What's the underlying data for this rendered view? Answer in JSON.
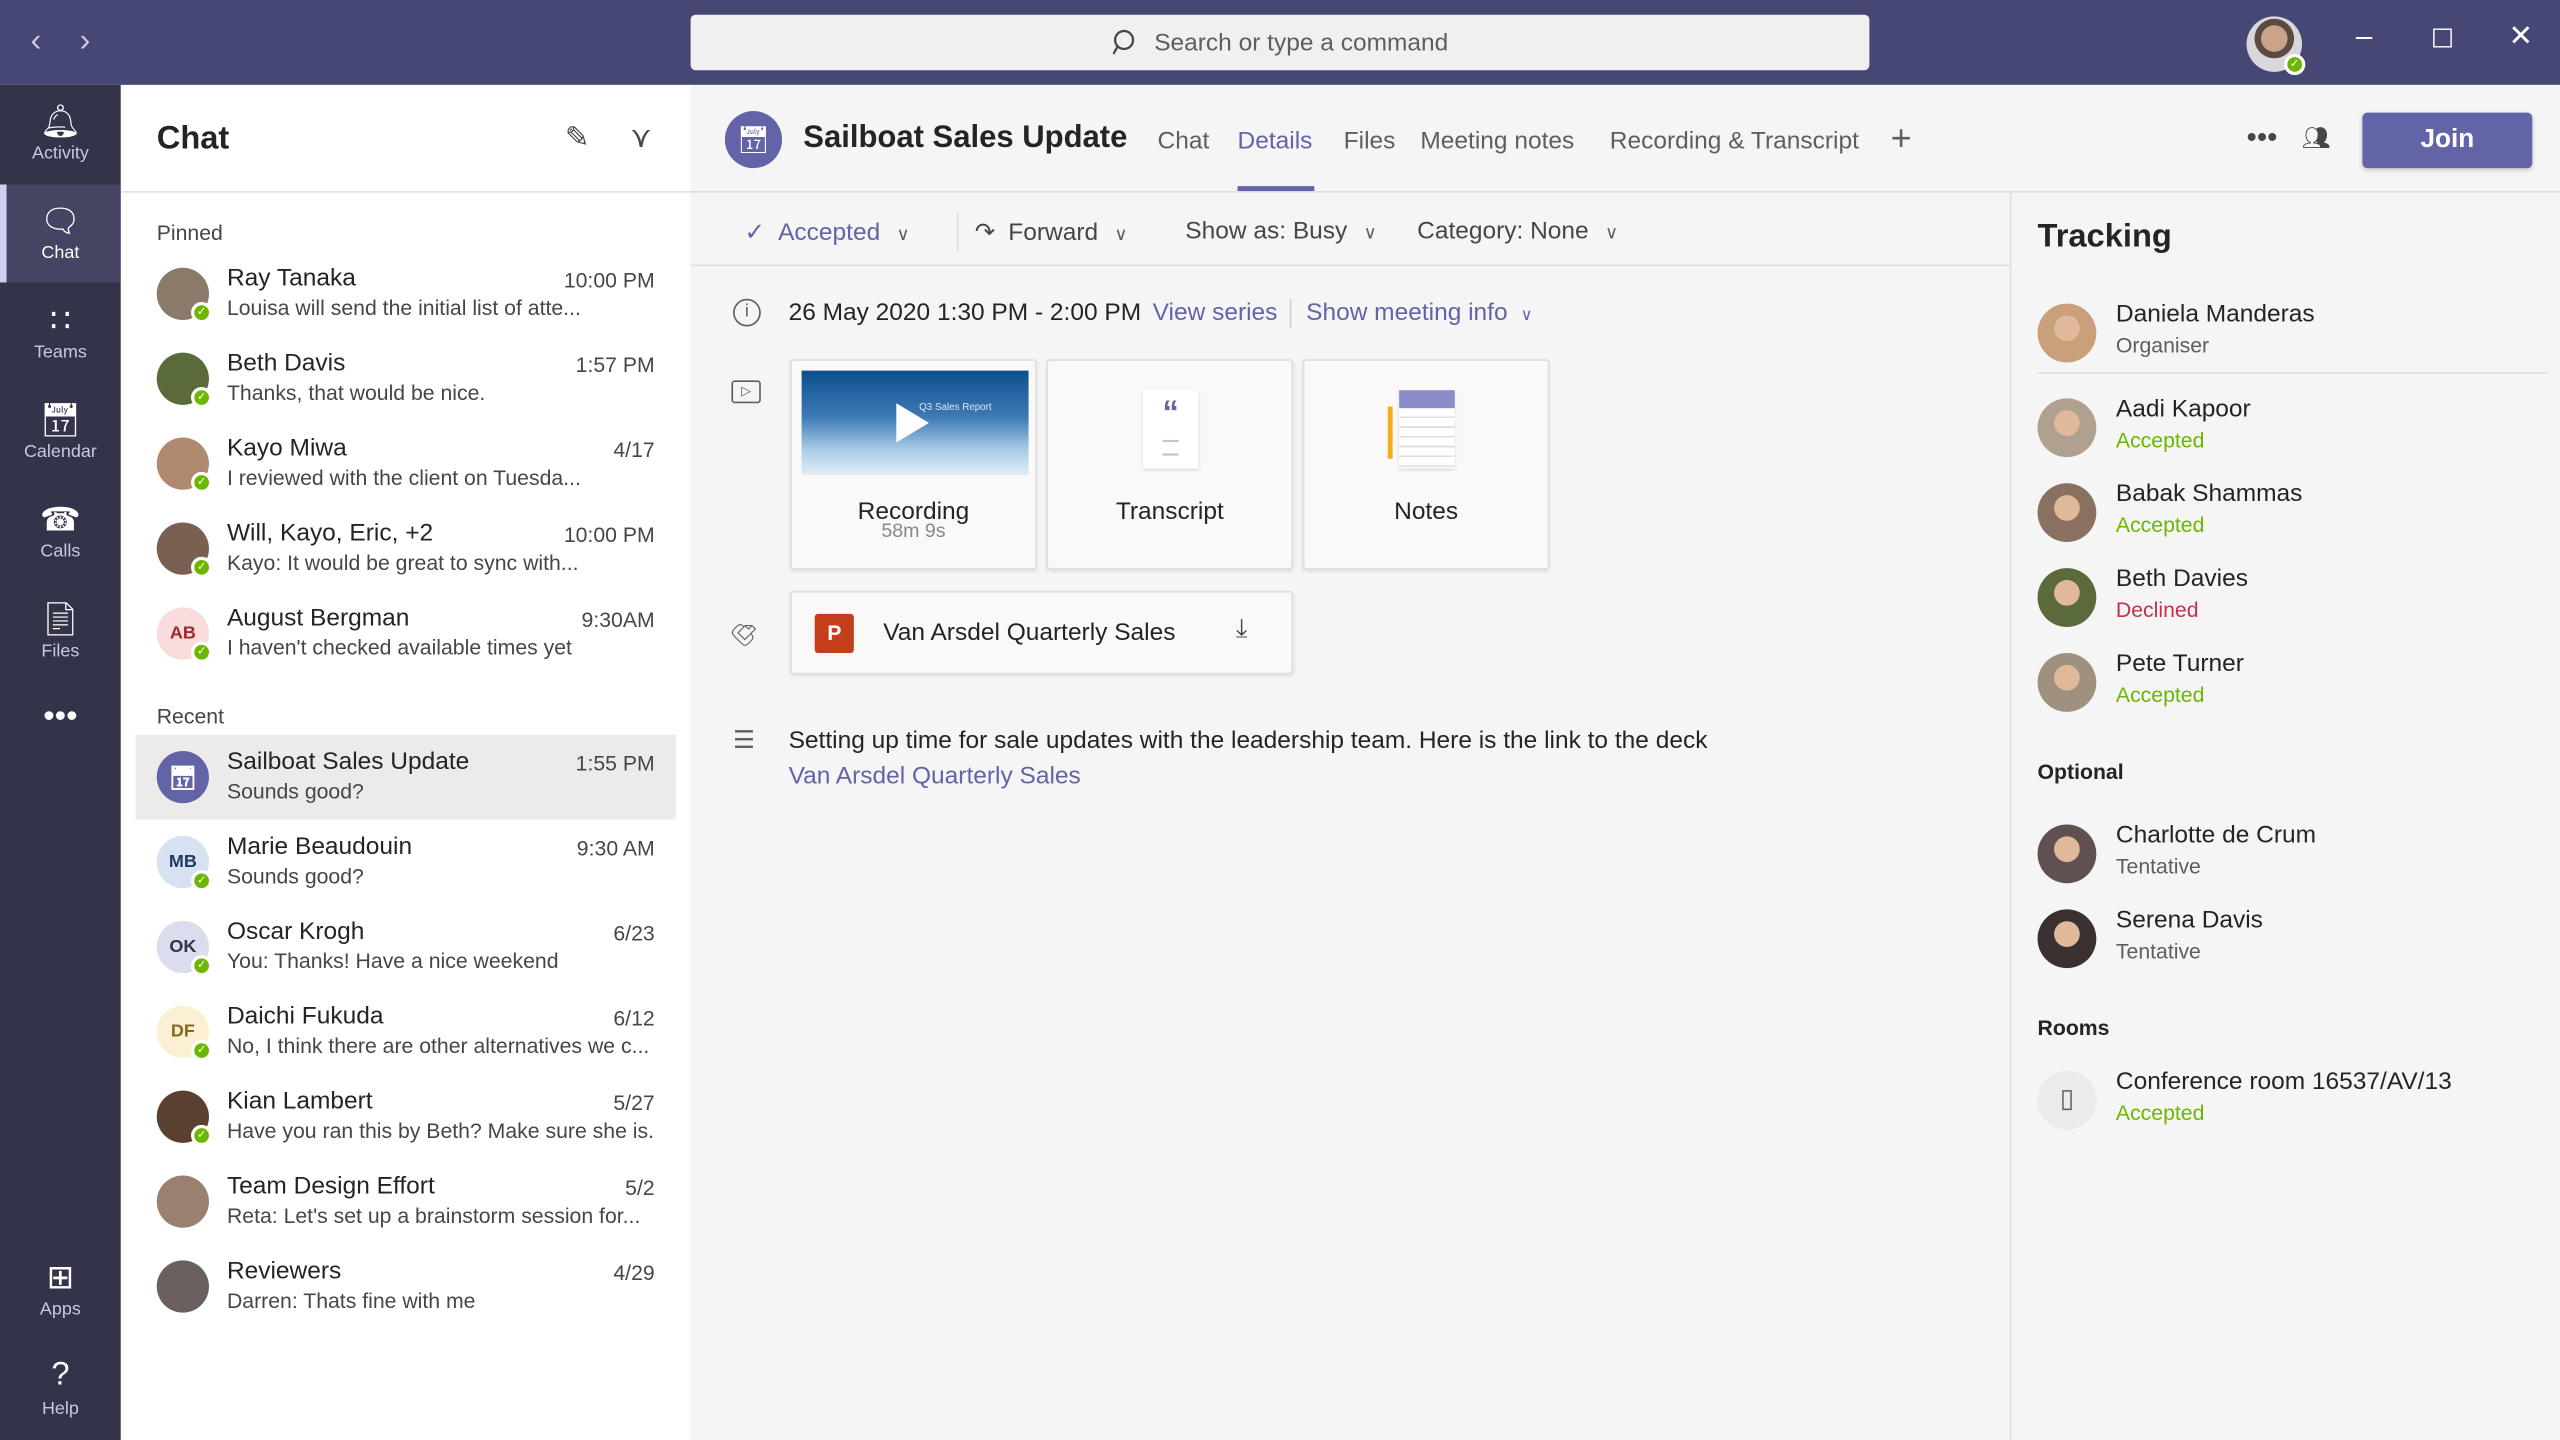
{
  "titlebar": {
    "search_placeholder": "Search or type a command",
    "back_icon": "chevron-left",
    "forward_icon": "chevron-right"
  },
  "rail": [
    {
      "label": "Activity",
      "icon": "bell"
    },
    {
      "label": "Chat",
      "icon": "chat",
      "active": true
    },
    {
      "label": "Teams",
      "icon": "teams"
    },
    {
      "label": "Calendar",
      "icon": "calendar"
    },
    {
      "label": "Calls",
      "icon": "phone"
    },
    {
      "label": "Files",
      "icon": "file"
    },
    {
      "label": "",
      "icon": "more"
    },
    {
      "label": "Apps",
      "icon": "apps"
    },
    {
      "label": "Help",
      "icon": "help"
    }
  ],
  "chat": {
    "title": "Chat",
    "pinned_label": "Pinned",
    "recent_label": "Recent",
    "pinned": [
      {
        "name": "Ray Tanaka",
        "time": "10:00 PM",
        "preview": "Louisa will send the initial list of atte...",
        "color": "#8a7a6a"
      },
      {
        "name": "Beth Davis",
        "time": "1:57 PM",
        "preview": "Thanks, that would be nice.",
        "color": "#5a6a3a"
      },
      {
        "name": "Kayo Miwa",
        "time": "4/17",
        "preview": "I reviewed with the client on Tuesda...",
        "color": "#b08a70"
      },
      {
        "name": "Will, Kayo, Eric, +2",
        "time": "10:00 PM",
        "preview": "Kayo: It would be great to sync with...",
        "color": "#7a6050"
      },
      {
        "name": "August Bergman",
        "time": "9:30AM",
        "preview": "I haven't checked available times yet",
        "initials": "AB",
        "color": "#fbdcdc",
        "text_color": "#a4262c"
      }
    ],
    "recent": [
      {
        "name": "Sailboat Sales Update",
        "time": "1:55 PM",
        "preview": "Sounds good?",
        "meeting": true,
        "color": "#6264a7",
        "selected": true
      },
      {
        "name": "Marie Beaudouin",
        "time": "9:30 AM",
        "preview": "Sounds good?",
        "initials": "MB",
        "color": "#d6e1f2",
        "text_color": "#243a5e"
      },
      {
        "name": "Oscar Krogh",
        "time": "6/23",
        "preview": "You: Thanks! Have a nice weekend",
        "initials": "OK",
        "color": "#dcdcef",
        "text_color": "#33344a"
      },
      {
        "name": "Daichi Fukuda",
        "time": "6/12",
        "preview": "No, I think there are other alternatives we c...",
        "initials": "DF",
        "color": "#fbefd4",
        "text_color": "#8a6a1a"
      },
      {
        "name": "Kian Lambert",
        "time": "5/27",
        "preview": "Have you ran this by Beth? Make sure she is...",
        "color": "#5a4030"
      },
      {
        "name": "Team Design Effort",
        "time": "5/2",
        "preview": "Reta: Let's set up a brainstorm session for...",
        "color": "#9a8070"
      },
      {
        "name": "Reviewers",
        "time": "4/29",
        "preview": "Darren: Thats fine with me",
        "color": "#6a6060"
      }
    ]
  },
  "meeting": {
    "title": "Sailboat Sales Update",
    "tabs": [
      {
        "label": "Chat"
      },
      {
        "label": "Details",
        "active": true
      },
      {
        "label": "Files"
      },
      {
        "label": "Meeting notes"
      },
      {
        "label": "Recording & Transcript"
      }
    ],
    "join_label": "Join",
    "toolbar": {
      "rsvp": "Accepted",
      "forward": "Forward",
      "show_as": "Show as: Busy",
      "category": "Category: None"
    },
    "datetime": "26 May 2020 1:30 PM - 2:00 PM",
    "view_series": "View series",
    "show_info": "Show meeting info",
    "recording": {
      "label": "Recording",
      "duration": "58m 9s",
      "thumb_text": "Q3 Sales Report"
    },
    "transcript_label": "Transcript",
    "notes_label": "Notes",
    "attachment": "Van Arsdel Quarterly Sales",
    "description": "Setting up time for sale updates with the leadership team. Here is the link to the deck",
    "description_link": "Van Arsdel Quarterly Sales"
  },
  "tracking": {
    "title": "Tracking",
    "organiser": {
      "name": "Daniela Manderas",
      "status": "Organiser"
    },
    "required": [
      {
        "name": "Aadi Kapoor",
        "status": "Accepted"
      },
      {
        "name": "Babak Shammas",
        "status": "Accepted"
      },
      {
        "name": "Beth Davies",
        "status": "Declined"
      },
      {
        "name": "Pete Turner",
        "status": "Accepted"
      }
    ],
    "optional_label": "Optional",
    "optional": [
      {
        "name": "Charlotte de Crum",
        "status": "Tentative"
      },
      {
        "name": "Serena Davis",
        "status": "Tentative"
      }
    ],
    "rooms_label": "Rooms",
    "rooms": [
      {
        "name": "Conference room 16537/AV/13",
        "status": "Accepted"
      }
    ],
    "status_colors": {
      "Accepted": "#6bb700",
      "Declined": "#c4314b",
      "Tentative": "#605e5c",
      "Organiser": "#605e5c"
    }
  }
}
